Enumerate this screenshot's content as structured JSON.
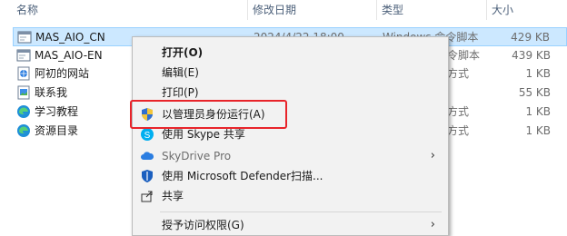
{
  "columns": {
    "name": "名称",
    "date": "修改日期",
    "type": "类型",
    "size": "大小"
  },
  "files": [
    {
      "name": "MAS_AIO_CN",
      "date": "2024/4/22 18:00",
      "type": "Windows 命令脚本",
      "size": "429 KB",
      "icon": "cmd-script-icon"
    },
    {
      "name": "MAS_AIO-EN",
      "date": "",
      "type": "命令脚本",
      "size": "439 KB",
      "icon": "cmd-script-icon"
    },
    {
      "name": "阿初的网站",
      "date": "",
      "type": "方式",
      "size": "1 KB",
      "icon": "url-shortcut-icon"
    },
    {
      "name": "联系我",
      "date": "",
      "type": "",
      "size": "55 KB",
      "icon": "image-file-icon"
    },
    {
      "name": "学习教程",
      "date": "",
      "type": "方式",
      "size": "1 KB",
      "icon": "edge-shortcut-icon"
    },
    {
      "name": "资源目录",
      "date": "",
      "type": "方式",
      "size": "1 KB",
      "icon": "edge-shortcut-icon"
    }
  ],
  "context_menu": {
    "open": "打开(O)",
    "edit": "编辑(E)",
    "print": "打印(P)",
    "run_as_admin": "以管理员身份运行(A)",
    "skype_share": "使用 Skype 共享",
    "skydrive": "SkyDrive Pro",
    "defender": "使用 Microsoft Defender扫描...",
    "share": "共享",
    "grant_access": "授予访问权限(G)"
  },
  "colors": {
    "selection_bg": "#cce8ff",
    "highlight_border": "#e8242a",
    "menu_bg": "#f2f2f2"
  }
}
